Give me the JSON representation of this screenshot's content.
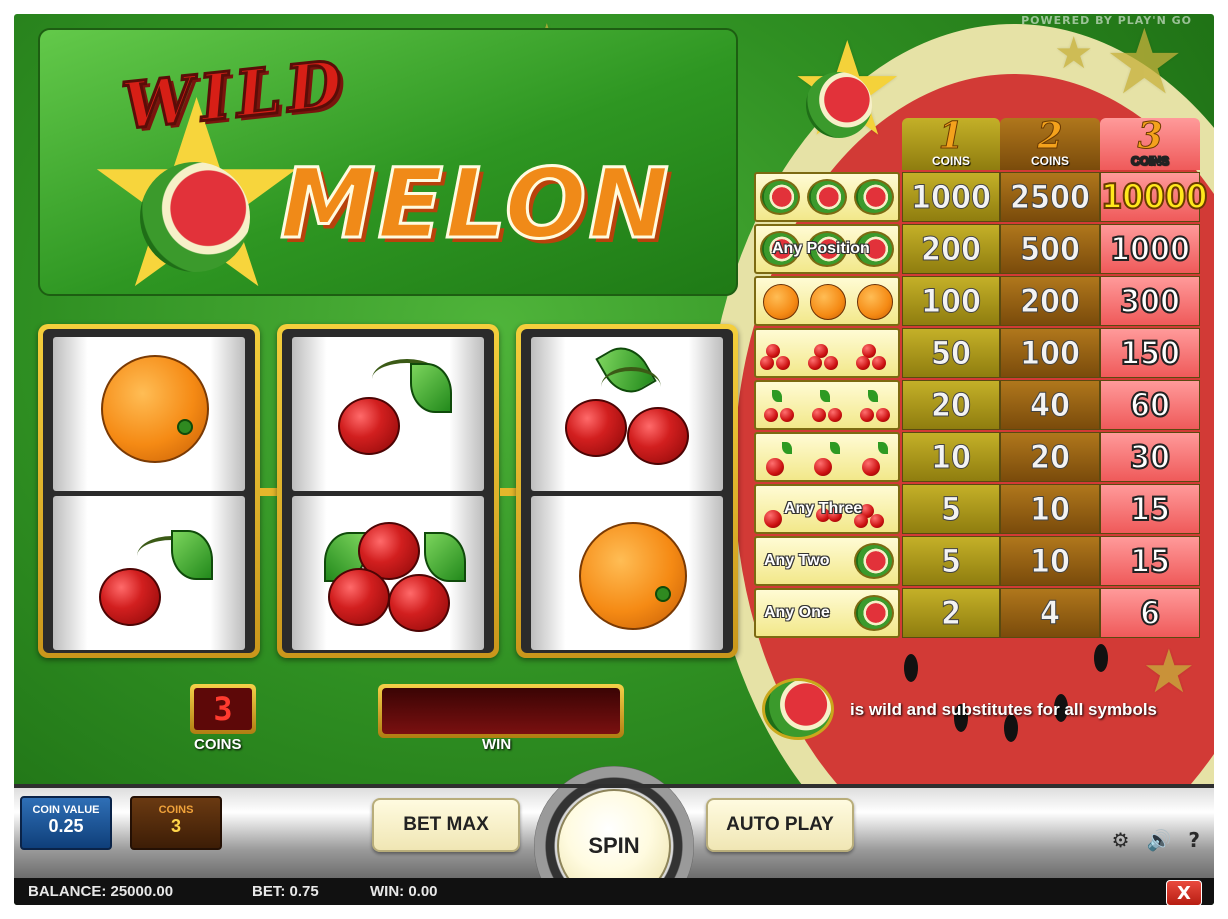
{
  "branding": {
    "powered_by": "POWERED BY PLAY'N GO"
  },
  "logo": {
    "line1": "WILD",
    "line2": "MELON"
  },
  "reels": [
    {
      "top": "orange",
      "bottom": "single-cherry"
    },
    {
      "top": "single-cherry",
      "bottom": "triple-cherry"
    },
    {
      "top": "double-cherry",
      "bottom": "orange"
    }
  ],
  "coins_display": {
    "value": "3",
    "label": "COINS"
  },
  "win_display": {
    "value": "",
    "label": "WIN"
  },
  "paytable": {
    "headers": [
      {
        "num": "1",
        "label": "COINS"
      },
      {
        "num": "2",
        "label": "COINS"
      },
      {
        "num": "3",
        "label": "COINS"
      }
    ],
    "rows": [
      {
        "symbol": "three-melons",
        "text": "",
        "pays": [
          "1000",
          "2500",
          "10000"
        ]
      },
      {
        "symbol": "melons-any-position",
        "text": "Any Position",
        "pays": [
          "200",
          "500",
          "1000"
        ]
      },
      {
        "symbol": "three-oranges",
        "text": "",
        "pays": [
          "100",
          "200",
          "300"
        ]
      },
      {
        "symbol": "three-triple-cherries",
        "text": "",
        "pays": [
          "50",
          "100",
          "150"
        ]
      },
      {
        "symbol": "three-double-cherries",
        "text": "",
        "pays": [
          "20",
          "40",
          "60"
        ]
      },
      {
        "symbol": "three-single-cherries",
        "text": "",
        "pays": [
          "10",
          "20",
          "30"
        ]
      },
      {
        "symbol": "any-three-cherries",
        "text": "Any Three",
        "pays": [
          "5",
          "10",
          "15"
        ]
      },
      {
        "symbol": "any-two-melon",
        "text": "Any Two",
        "pays": [
          "5",
          "10",
          "15"
        ]
      },
      {
        "symbol": "any-one-melon",
        "text": "Any One",
        "pays": [
          "2",
          "4",
          "6"
        ]
      }
    ]
  },
  "wild_note": "is wild and substitutes for all symbols",
  "controls": {
    "coin_value_label": "COIN VALUE",
    "coin_value": "0.25",
    "coins_label": "COINS",
    "coins": "3",
    "bet_max": "BET MAX",
    "spin": "SPIN",
    "auto_play": "AUTO PLAY",
    "settings_icon": "gear-icon",
    "sound_icon": "speaker-icon",
    "help": "?"
  },
  "status": {
    "balance": "BALANCE: 25000.00",
    "bet": "BET: 0.75",
    "win": "WIN: 0.00",
    "close": "X"
  },
  "colors": {
    "accent_gold": "#f4cf3c",
    "felt_green": "#2f8f22",
    "melon_red": "#d23a36"
  }
}
